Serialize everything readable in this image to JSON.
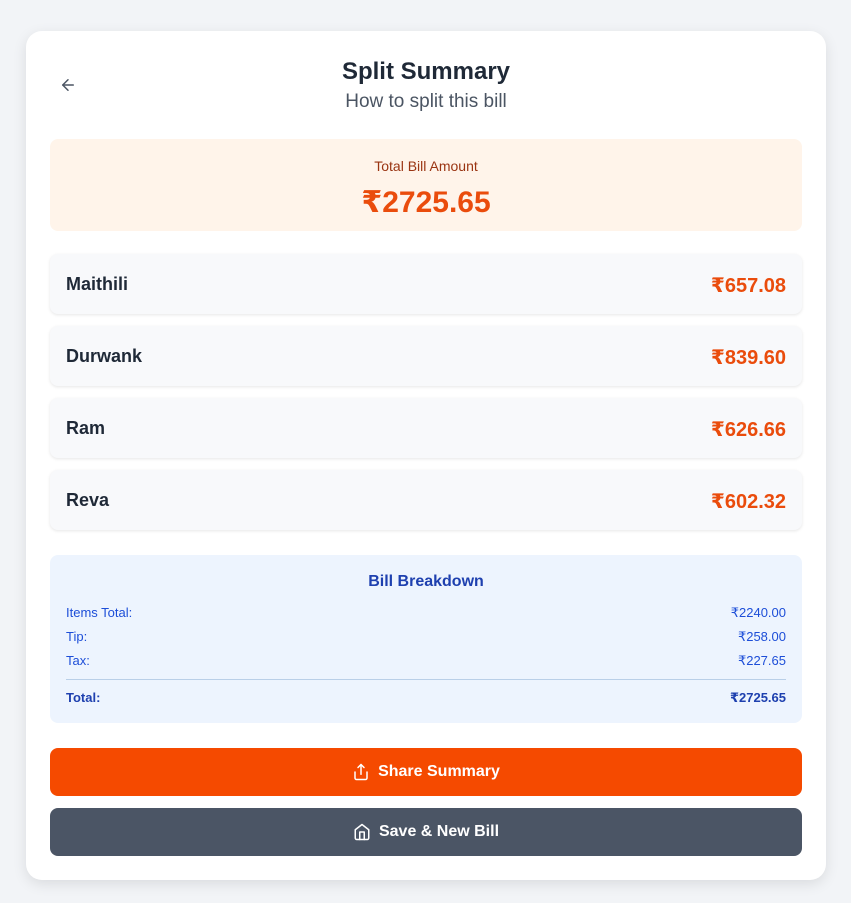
{
  "header": {
    "back_icon": "arrow-left-icon",
    "title": "Split Summary",
    "subtitle": "How to split this bill"
  },
  "total": {
    "label": "Total Bill Amount",
    "amount": "₹2725.65"
  },
  "people": [
    {
      "name": "Maithili",
      "amount": "₹657.08"
    },
    {
      "name": "Durwank",
      "amount": "₹839.60"
    },
    {
      "name": "Ram",
      "amount": "₹626.66"
    },
    {
      "name": "Reva",
      "amount": "₹602.32"
    }
  ],
  "breakdown": {
    "title": "Bill Breakdown",
    "items_label": "Items Total:",
    "items_value": "₹2240.00",
    "tip_label": "Tip:",
    "tip_value": "₹258.00",
    "tax_label": "Tax:",
    "tax_value": "₹227.65",
    "total_label": "Total:",
    "total_value": "₹2725.65"
  },
  "actions": {
    "share_label": "Share Summary",
    "share_icon": "share-icon",
    "save_label": "Save & New Bill",
    "save_icon": "home-icon"
  },
  "colors": {
    "accent": "#f54a00",
    "amount": "#ea4c0c",
    "breakdown_text": "#1e40af",
    "secondary_button": "#4b5565"
  }
}
